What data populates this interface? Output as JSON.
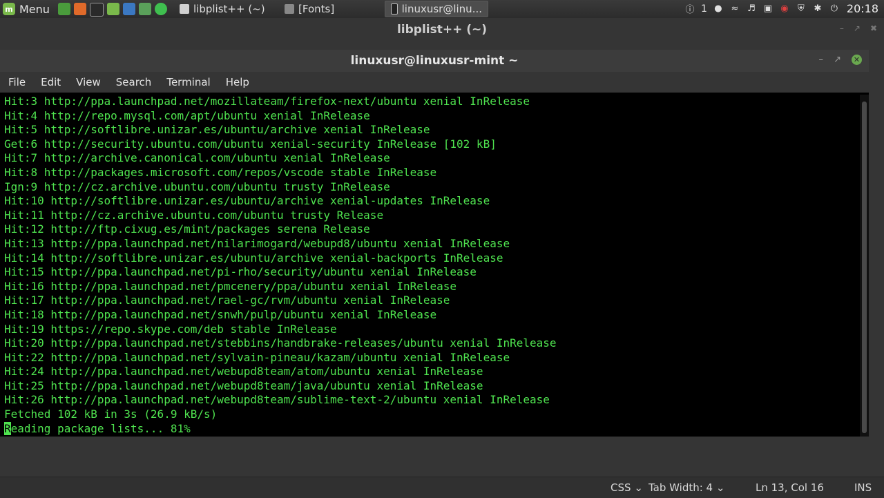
{
  "panel": {
    "menu_label": "Menu",
    "tasks": [
      {
        "label": "libplist++ (~)"
      },
      {
        "label": "[Fonts]"
      },
      {
        "label": "linuxusr@linu..."
      }
    ],
    "workspace_number": "1",
    "clock": "20:18"
  },
  "editor": {
    "title": "libplist++ (~)",
    "status": {
      "language": "CSS",
      "tab_width": "Tab Width: 4",
      "position": "Ln 13, Col 16",
      "mode": "INS"
    }
  },
  "terminal": {
    "title": "linuxusr@linuxusr-mint ~",
    "menu": [
      "File",
      "Edit",
      "View",
      "Search",
      "Terminal",
      "Help"
    ],
    "lines": [
      "Hit:3 http://ppa.launchpad.net/mozillateam/firefox-next/ubuntu xenial InRelease",
      "Hit:4 http://repo.mysql.com/apt/ubuntu xenial InRelease",
      "Hit:5 http://softlibre.unizar.es/ubuntu/archive xenial InRelease",
      "Get:6 http://security.ubuntu.com/ubuntu xenial-security InRelease [102 kB]",
      "Hit:7 http://archive.canonical.com/ubuntu xenial InRelease",
      "Hit:8 http://packages.microsoft.com/repos/vscode stable InRelease",
      "Ign:9 http://cz.archive.ubuntu.com/ubuntu trusty InRelease",
      "Hit:10 http://softlibre.unizar.es/ubuntu/archive xenial-updates InRelease",
      "Hit:11 http://cz.archive.ubuntu.com/ubuntu trusty Release",
      "Hit:12 http://ftp.cixug.es/mint/packages serena Release",
      "Hit:13 http://ppa.launchpad.net/nilarimogard/webupd8/ubuntu xenial InRelease",
      "Hit:14 http://softlibre.unizar.es/ubuntu/archive xenial-backports InRelease",
      "Hit:15 http://ppa.launchpad.net/pi-rho/security/ubuntu xenial InRelease",
      "Hit:16 http://ppa.launchpad.net/pmcenery/ppa/ubuntu xenial InRelease",
      "Hit:17 http://ppa.launchpad.net/rael-gc/rvm/ubuntu xenial InRelease",
      "Hit:18 http://ppa.launchpad.net/snwh/pulp/ubuntu xenial InRelease",
      "Hit:19 https://repo.skype.com/deb stable InRelease",
      "Hit:20 http://ppa.launchpad.net/stebbins/handbrake-releases/ubuntu xenial InRelease",
      "Hit:22 http://ppa.launchpad.net/sylvain-pineau/kazam/ubuntu xenial InRelease",
      "Hit:24 http://ppa.launchpad.net/webupd8team/atom/ubuntu xenial InRelease",
      "Hit:25 http://ppa.launchpad.net/webupd8team/java/ubuntu xenial InRelease",
      "Hit:26 http://ppa.launchpad.net/webupd8team/sublime-text-2/ubuntu xenial InRelease",
      "Fetched 102 kB in 3s (26.9 kB/s)"
    ],
    "prompt_cursor_char": "R",
    "prompt_rest": "eading package lists... 81%"
  },
  "colors": {
    "terminal_fg": "#4fe34f",
    "terminal_bg": "#000000",
    "accent_green": "#6aa84f"
  }
}
